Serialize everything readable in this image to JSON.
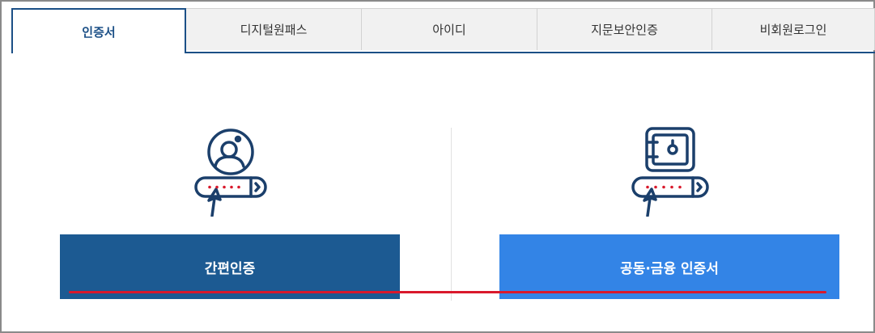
{
  "tabs": [
    {
      "label": "인증서",
      "active": true
    },
    {
      "label": "디지털원패스",
      "active": false
    },
    {
      "label": "아이디",
      "active": false
    },
    {
      "label": "지문보안인증",
      "active": false
    },
    {
      "label": "비회원로그인",
      "active": false
    }
  ],
  "options": {
    "simple_auth": {
      "label": "간편인증",
      "icon": "user-password-icon",
      "color": "#1c5a92"
    },
    "joint_cert": {
      "label": "공동·금융 인증서",
      "icon": "safe-password-icon",
      "color": "#3384e6"
    }
  },
  "colors": {
    "navy": "#1b4f86",
    "accent_red": "#d9192c",
    "tab_bg": "#f1f1f1"
  }
}
